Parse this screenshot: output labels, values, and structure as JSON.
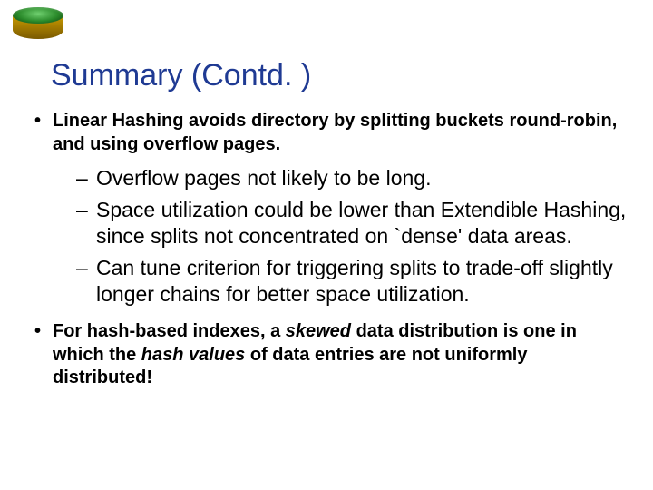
{
  "title": "Summary (Contd. )",
  "bullets": {
    "b1": "Linear Hashing avoids directory by splitting buckets round-robin, and using overflow pages.",
    "b1_sub1": "Overflow pages not likely to be long.",
    "b1_sub2": "Space utilization could be lower than Extendible Hashing, since splits not concentrated on `dense' data areas.",
    "b1_sub3": "Can tune criterion for triggering splits to trade-off slightly longer chains for better space utilization.",
    "b2_pre": "For hash-based indexes, a ",
    "b2_skewed": "skewed",
    "b2_mid": " data distribution is one in which the ",
    "b2_hash": "hash values",
    "b2_post": " of data entries are not uniformly distributed!"
  }
}
